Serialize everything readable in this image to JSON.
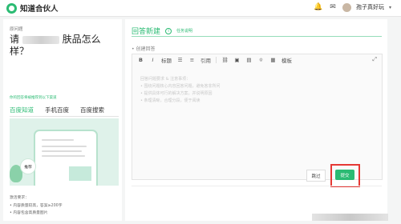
{
  "header": {
    "logo_text": "知道合伙人",
    "username": "孢子真好玩",
    "icons": [
      "bell-icon",
      "mail-icon"
    ]
  },
  "question": {
    "label": "原问题",
    "title_prefix": "请",
    "title_suffix": "肤品怎么样？"
  },
  "side": {
    "hint": "你的回答将被推荐到以下渠道",
    "tabs": [
      {
        "label": "百度知道",
        "active": true
      },
      {
        "label": "手机百度",
        "active": false
      },
      {
        "label": "百度搜索",
        "active": false
      }
    ],
    "tag": "推荐",
    "requirements_title": "激活要求：",
    "requirements": [
      "• 内容质量较高，答案≥200字",
      "• 内容包含高质量图片"
    ]
  },
  "answer": {
    "title": "回答新建",
    "info_link": "任务说明",
    "subtitle": "• 创建回答",
    "toolbar": [
      "B",
      "I",
      "标题",
      "",
      "",
      "引用",
      "",
      "",
      "",
      "",
      "",
      "模板",
      "⤢"
    ],
    "placeholder_lines": [
      "回答问题要求 & 注意事项：",
      "• 围绕问题核心内容回答问题，避免答非所问",
      "• 提供具体可行的解决方案，并说明原因",
      "• 条理清晰，合理分段，便于阅读"
    ],
    "skip_label": "跳过",
    "submit_label": "提交"
  },
  "colors": {
    "brand_green": "#2bbb73",
    "highlight_red": "#e53935"
  }
}
